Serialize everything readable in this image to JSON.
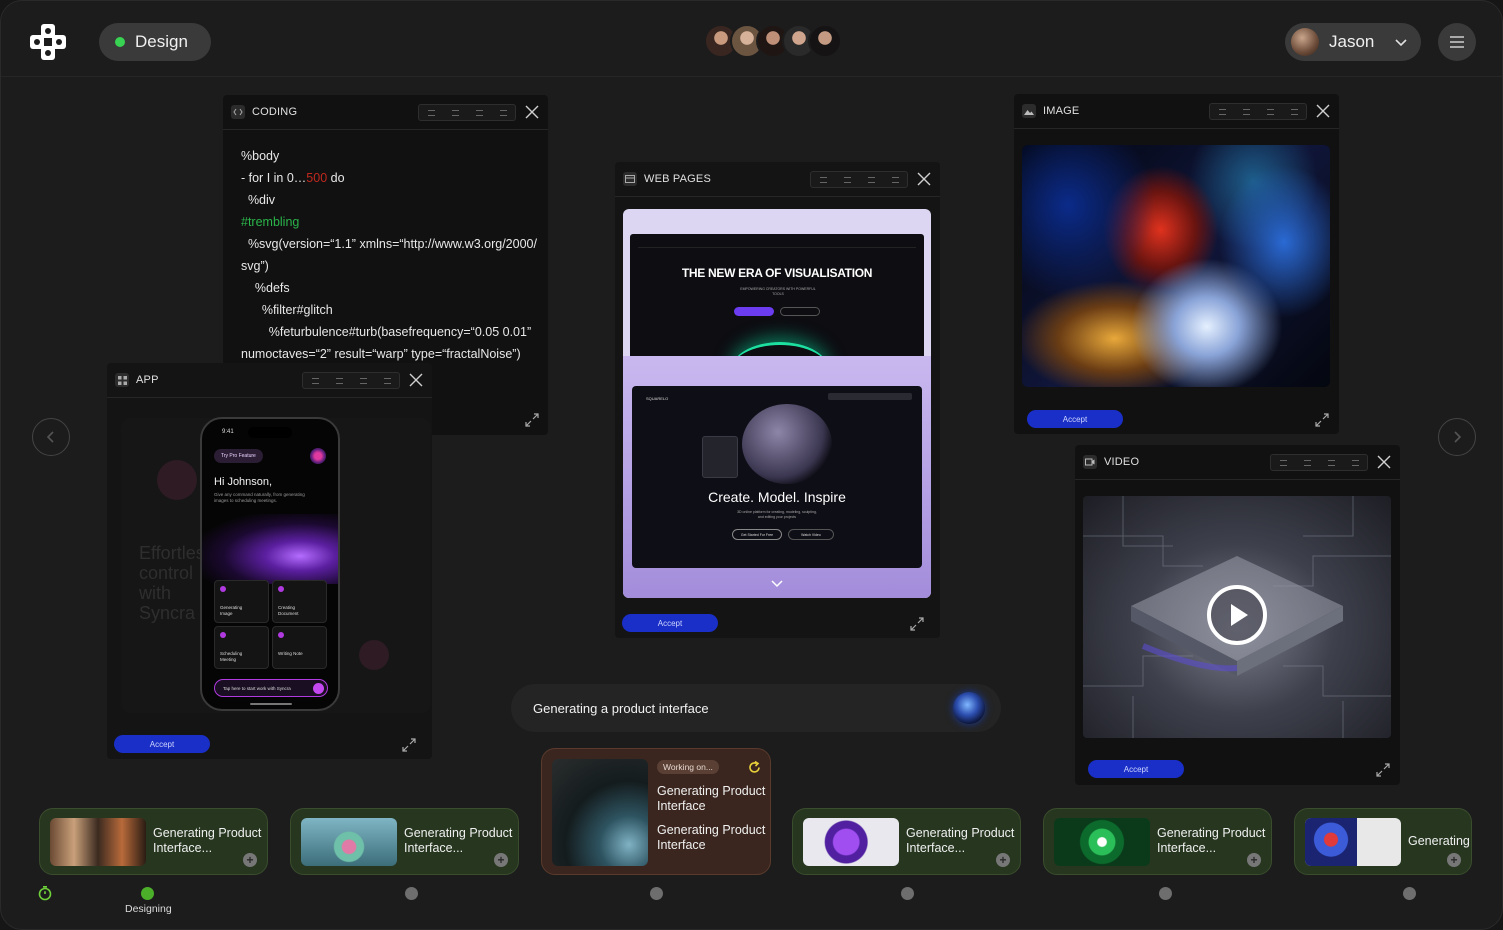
{
  "header": {
    "mode_label": "Design",
    "mode_status_color": "#39d353",
    "user_name": "Jason",
    "collaborators": 5,
    "icons": [
      "logo-icon",
      "chevron-down-icon",
      "menu-icon"
    ]
  },
  "panels": {
    "coding": {
      "title": "CODING",
      "lines": [
        {
          "text": "%body"
        },
        {
          "pre": "- for I in 0…",
          "red": "500",
          "post": " do"
        },
        {
          "text": "  %div"
        },
        {
          "green": "#trembling"
        },
        {
          "text": "  %svg(version=“1.1” xmlns=“http://www.w3.org/2000/"
        },
        {
          "text": "svg”)"
        },
        {
          "text": "    %defs"
        },
        {
          "text": "      %filter#glitch"
        },
        {
          "text": "        %feturbulence#turb(basefrequency=“0.05 0.01”"
        },
        {
          "text": "numoctaves=“2” result=“warp” type=“fractalNoise”)"
        }
      ]
    },
    "app": {
      "title": "APP",
      "accept_label": "Accept",
      "phone": {
        "time": "9:41",
        "pill": "Try Pro Feature",
        "greeting": "Hi Johnson,",
        "subtitle": "Give any command naturally, from generating images to scheduling meetings.",
        "tiles": [
          "Generating Image",
          "Creating Document",
          "Scheduling Meeting",
          "Writing Note"
        ],
        "input_placeholder": "Tap here to start work with Syncra",
        "bg_text": "Effortless control with Syncra"
      }
    },
    "web": {
      "title": "WEB PAGES",
      "accept_label": "Accept",
      "hero1": "THE NEW ERA OF VISUALISATION",
      "hero1_sub": "EMPOWERING CREATORS WITH POWERFUL TOOLS",
      "hero2": "Create. Model. Inspire",
      "hero2_sub": "3D online platform for creating, modeling, sculpting, and editing your projects",
      "hero2_cta1": "Get Started For Free",
      "hero2_cta2": "Watch Video",
      "brand2": "SQUARELO"
    },
    "image": {
      "title": "IMAGE",
      "accept_label": "Accept"
    },
    "video": {
      "title": "VIDEO",
      "accept_label": "Accept"
    }
  },
  "prompt": {
    "text": "Generating a product interface"
  },
  "queue": [
    {
      "title": "Generating Product Interface..."
    },
    {
      "title": "Generating Product Interface..."
    },
    {
      "badge": "Working on...",
      "line1": "Generating Product Interface",
      "line2": "Generating Product Interface"
    },
    {
      "title": "Generating Product Interface..."
    },
    {
      "title": "Generating Product Interface..."
    },
    {
      "title": "Generating"
    }
  ],
  "status": {
    "label": "Designing",
    "active_color": "#4caf2a"
  }
}
